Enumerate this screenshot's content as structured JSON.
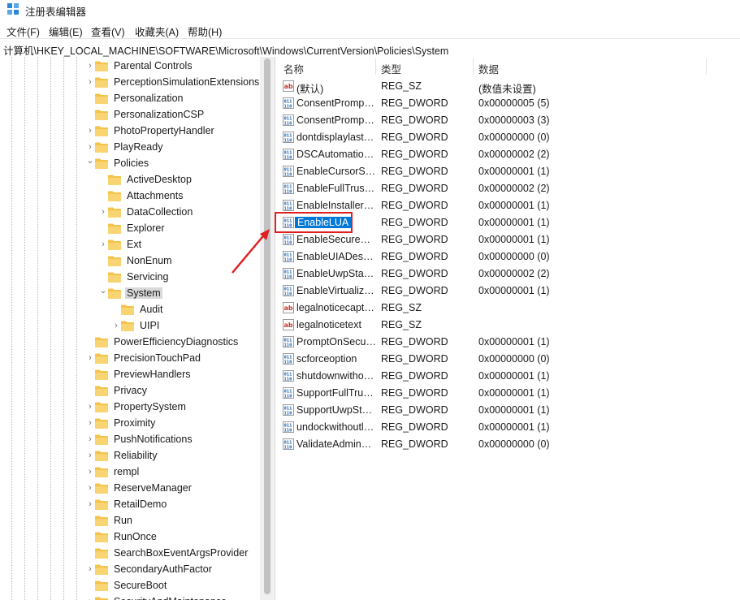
{
  "window": {
    "title": "注册表编辑器"
  },
  "menu": [
    "文件(F)",
    "编辑(E)",
    "查看(V)",
    "收藏夹(A)",
    "帮助(H)"
  ],
  "address": "计算机\\HKEY_LOCAL_MACHINE\\SOFTWARE\\Microsoft\\Windows\\CurrentVersion\\Policies\\System",
  "tree": [
    {
      "label": "Parental Controls",
      "depth": 0,
      "chevron": "right"
    },
    {
      "label": "PerceptionSimulationExtensions",
      "depth": 0,
      "chevron": "right"
    },
    {
      "label": "Personalization",
      "depth": 0,
      "chevron": ""
    },
    {
      "label": "PersonalizationCSP",
      "depth": 0,
      "chevron": ""
    },
    {
      "label": "PhotoPropertyHandler",
      "depth": 0,
      "chevron": "right"
    },
    {
      "label": "PlayReady",
      "depth": 0,
      "chevron": "right"
    },
    {
      "label": "Policies",
      "depth": 0,
      "chevron": "down"
    },
    {
      "label": "ActiveDesktop",
      "depth": 1,
      "chevron": ""
    },
    {
      "label": "Attachments",
      "depth": 1,
      "chevron": ""
    },
    {
      "label": "DataCollection",
      "depth": 1,
      "chevron": "right"
    },
    {
      "label": "Explorer",
      "depth": 1,
      "chevron": ""
    },
    {
      "label": "Ext",
      "depth": 1,
      "chevron": "right"
    },
    {
      "label": "NonEnum",
      "depth": 1,
      "chevron": ""
    },
    {
      "label": "Servicing",
      "depth": 1,
      "chevron": ""
    },
    {
      "label": "System",
      "depth": 1,
      "chevron": "down",
      "selected": true
    },
    {
      "label": "Audit",
      "depth": 2,
      "chevron": ""
    },
    {
      "label": "UIPI",
      "depth": 2,
      "chevron": "right"
    },
    {
      "label": "PowerEfficiencyDiagnostics",
      "depth": 0,
      "chevron": ""
    },
    {
      "label": "PrecisionTouchPad",
      "depth": 0,
      "chevron": "right"
    },
    {
      "label": "PreviewHandlers",
      "depth": 0,
      "chevron": ""
    },
    {
      "label": "Privacy",
      "depth": 0,
      "chevron": ""
    },
    {
      "label": "PropertySystem",
      "depth": 0,
      "chevron": "right"
    },
    {
      "label": "Proximity",
      "depth": 0,
      "chevron": "right"
    },
    {
      "label": "PushNotifications",
      "depth": 0,
      "chevron": "right"
    },
    {
      "label": "Reliability",
      "depth": 0,
      "chevron": "right"
    },
    {
      "label": "rempl",
      "depth": 0,
      "chevron": "right"
    },
    {
      "label": "ReserveManager",
      "depth": 0,
      "chevron": "right"
    },
    {
      "label": "RetailDemo",
      "depth": 0,
      "chevron": "right"
    },
    {
      "label": "Run",
      "depth": 0,
      "chevron": ""
    },
    {
      "label": "RunOnce",
      "depth": 0,
      "chevron": ""
    },
    {
      "label": "SearchBoxEventArgsProvider",
      "depth": 0,
      "chevron": ""
    },
    {
      "label": "SecondaryAuthFactor",
      "depth": 0,
      "chevron": "right"
    },
    {
      "label": "SecureBoot",
      "depth": 0,
      "chevron": ""
    },
    {
      "label": "SecurityAndMaintenance",
      "depth": 0,
      "chevron": "right"
    }
  ],
  "columns": {
    "name": "名称",
    "type": "类型",
    "data": "数据"
  },
  "values": [
    {
      "name": "(默认)",
      "type": "REG_SZ",
      "data": "(数值未设置)",
      "icon": "string-value-icon"
    },
    {
      "name": "ConsentPromptBehaviorAdmin",
      "type": "REG_DWORD",
      "data": "0x00000005 (5)",
      "icon": "dword-value-icon"
    },
    {
      "name": "ConsentPromptBehaviorUser",
      "type": "REG_DWORD",
      "data": "0x00000003 (3)",
      "icon": "dword-value-icon"
    },
    {
      "name": "dontdisplaylastusername",
      "type": "REG_DWORD",
      "data": "0x00000000 (0)",
      "icon": "dword-value-icon"
    },
    {
      "name": "DSCAutomationHostEnabled",
      "type": "REG_DWORD",
      "data": "0x00000002 (2)",
      "icon": "dword-value-icon"
    },
    {
      "name": "EnableCursorSuppression",
      "type": "REG_DWORD",
      "data": "0x00000001 (1)",
      "icon": "dword-value-icon"
    },
    {
      "name": "EnableFullTrustStartupTasks",
      "type": "REG_DWORD",
      "data": "0x00000002 (2)",
      "icon": "dword-value-icon"
    },
    {
      "name": "EnableInstallerDetection",
      "type": "REG_DWORD",
      "data": "0x00000001 (1)",
      "icon": "dword-value-icon"
    },
    {
      "name": "EnableLUA",
      "type": "REG_DWORD",
      "data": "0x00000001 (1)",
      "icon": "dword-value-icon",
      "highlight": true
    },
    {
      "name": "EnableSecureUIAPaths",
      "type": "REG_DWORD",
      "data": "0x00000001 (1)",
      "icon": "dword-value-icon"
    },
    {
      "name": "EnableUIADesktopToggle",
      "type": "REG_DWORD",
      "data": "0x00000000 (0)",
      "icon": "dword-value-icon"
    },
    {
      "name": "EnableUwpStartupTasks",
      "type": "REG_DWORD",
      "data": "0x00000002 (2)",
      "icon": "dword-value-icon"
    },
    {
      "name": "EnableVirtualization",
      "type": "REG_DWORD",
      "data": "0x00000001 (1)",
      "icon": "dword-value-icon"
    },
    {
      "name": "legalnoticecaption",
      "type": "REG_SZ",
      "data": "",
      "icon": "string-value-icon"
    },
    {
      "name": "legalnoticetext",
      "type": "REG_SZ",
      "data": "",
      "icon": "string-value-icon"
    },
    {
      "name": "PromptOnSecureDesktop",
      "type": "REG_DWORD",
      "data": "0x00000001 (1)",
      "icon": "dword-value-icon"
    },
    {
      "name": "scforceoption",
      "type": "REG_DWORD",
      "data": "0x00000000 (0)",
      "icon": "dword-value-icon"
    },
    {
      "name": "shutdownwithoutlogon",
      "type": "REG_DWORD",
      "data": "0x00000001 (1)",
      "icon": "dword-value-icon"
    },
    {
      "name": "SupportFullTrustStartupTasks",
      "type": "REG_DWORD",
      "data": "0x00000001 (1)",
      "icon": "dword-value-icon"
    },
    {
      "name": "SupportUwpStartupTasks",
      "type": "REG_DWORD",
      "data": "0x00000001 (1)",
      "icon": "dword-value-icon"
    },
    {
      "name": "undockwithoutlogon",
      "type": "REG_DWORD",
      "data": "0x00000001 (1)",
      "icon": "dword-value-icon"
    },
    {
      "name": "ValidateAdminCodeSignatures",
      "type": "REG_DWORD",
      "data": "0x00000000 (0)",
      "icon": "dword-value-icon"
    }
  ],
  "colors": {
    "folder": "#f3c34a",
    "selection": "#0078d7",
    "annotation": "#e02020"
  }
}
